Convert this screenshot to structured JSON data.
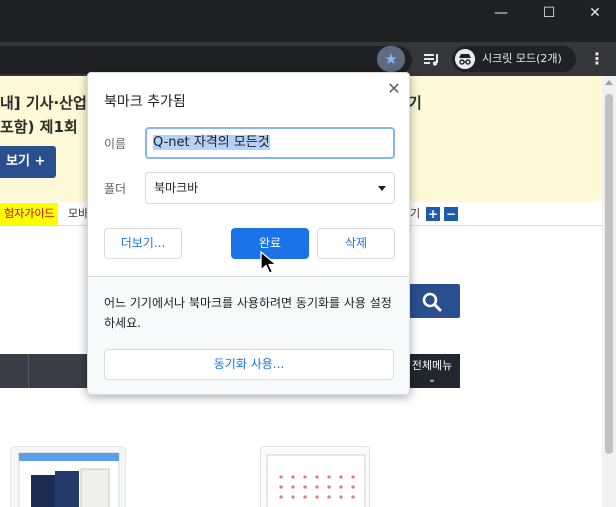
{
  "window": {
    "minimize_glyph": "—",
    "maximize_glyph": "☐",
    "close_glyph": "✕"
  },
  "toolbar": {
    "star_icon": "★",
    "incognito_label": "시크릿 모드(2개)",
    "menu_glyph": "⋮"
  },
  "page": {
    "banner_line1": "내] 기사·산업",
    "banner_line2": "포함) 제1회",
    "banner_right": "기",
    "view_button": "보기 +",
    "tab_yellow": "험자가이드",
    "tab_mobile": "모바",
    "tab_right": "기",
    "zoom_in": "+",
    "zoom_out": "−",
    "all_menu": "전체메뉴",
    "all_menu_arrow": "⌄"
  },
  "popup": {
    "title": "북마크 추가됨",
    "close_glyph": "✕",
    "name_label": "이름",
    "name_value": "Q-net 자격의 모든것",
    "folder_label": "폴더",
    "folder_value": "북마크바",
    "more_button": "더보기...",
    "done_button": "완료",
    "delete_button": "삭제",
    "sync_text": "어느 기기에서나 북마크를 사용하려면 동기화를 사용 설정하세요.",
    "sync_button": "동기화 사용..."
  },
  "colors": {
    "accent": "#1a73e8",
    "chrome_dark": "#202124",
    "banner_bg": "#fef9d6",
    "brand_blue": "#2a4f8f"
  }
}
